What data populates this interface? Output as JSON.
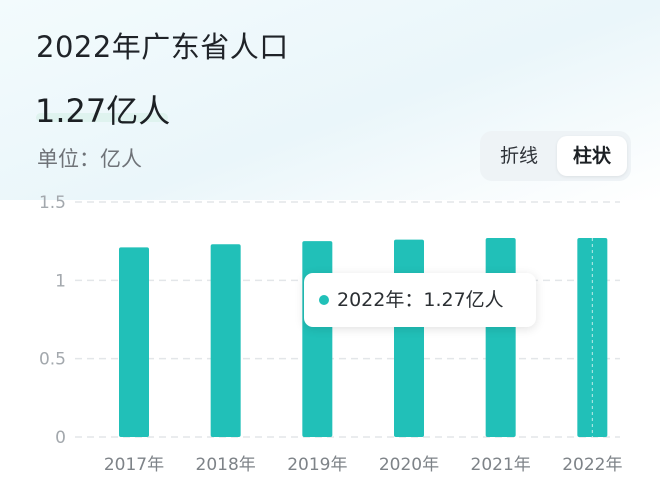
{
  "header": {
    "title": "2022年广东省人口",
    "value": "1.27亿人",
    "unit": "单位：亿人"
  },
  "toggle": {
    "line_label": "折线",
    "bar_label": "柱状"
  },
  "tooltip": {
    "text": "2022年：1.27亿人"
  },
  "colors": {
    "bar": "#21c0b8",
    "grid": "#e3e6e9",
    "tick": "#a3a8ad",
    "axis_label": "#7e8388"
  },
  "chart_data": {
    "type": "bar",
    "categories": [
      "2017年",
      "2018年",
      "2019年",
      "2020年",
      "2021年",
      "2022年"
    ],
    "values": [
      1.21,
      1.23,
      1.25,
      1.26,
      1.27,
      1.27
    ],
    "yticks": [
      "0",
      "0.5",
      "1",
      "1.5"
    ],
    "ylim": [
      0,
      1.5
    ],
    "grid": true,
    "highlight_index": 5
  }
}
